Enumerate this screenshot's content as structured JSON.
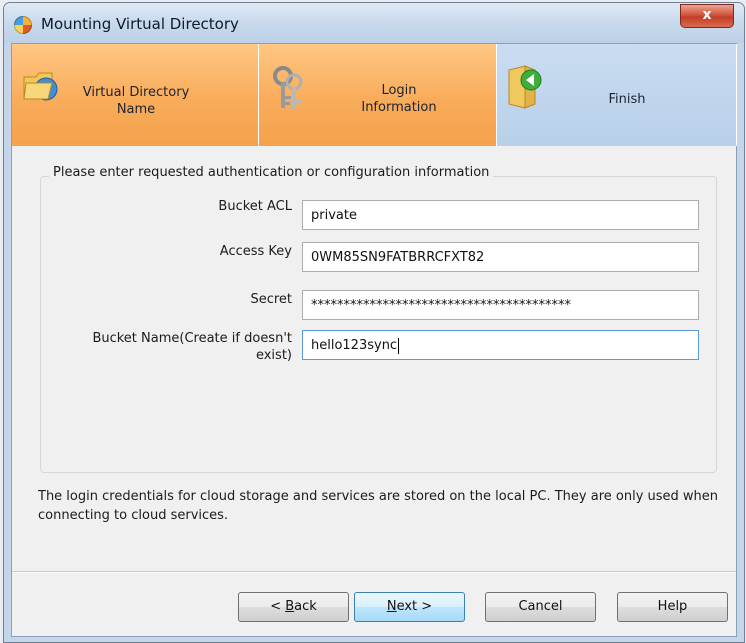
{
  "window": {
    "title": "Mounting Virtual Directory",
    "close_label": "x"
  },
  "steps": [
    {
      "label_line1": "Virtual Directory",
      "label_line2": "Name",
      "state": "active",
      "icon": "folder-globe-icon"
    },
    {
      "label_line1": "Login",
      "label_line2": "Information",
      "state": "active",
      "icon": "keys-icon"
    },
    {
      "label_line1": "Finish",
      "label_line2": "",
      "state": "inactive",
      "icon": "finish-folder-icon"
    }
  ],
  "group": {
    "legend": "Please enter requested authentication or configuration information",
    "fields": [
      {
        "label": "Bucket ACL",
        "value": "private"
      },
      {
        "label": "Access Key",
        "value": "0WM85SN9FATBRRCFXT82"
      },
      {
        "label": "Secret",
        "value": "****************************************"
      },
      {
        "label_line1": "Bucket Name(Create if doesn't",
        "label_line2": "exist)",
        "value": "hello123sync"
      }
    ]
  },
  "info_text": "The login credentials for cloud storage and services are stored on the local PC. They are only used when connecting to cloud services.",
  "buttons": {
    "back": {
      "pre": "< ",
      "mnemonic": "B",
      "post": "ack"
    },
    "next": {
      "pre": "",
      "mnemonic": "N",
      "post": "ext >"
    },
    "cancel": "Cancel",
    "help": "Help"
  },
  "colors": {
    "active_step": "#f8ac5a",
    "inactive_step": "#c9dcf1",
    "close_button": "#c94a30",
    "default_button_border": "#3c7fb1"
  }
}
